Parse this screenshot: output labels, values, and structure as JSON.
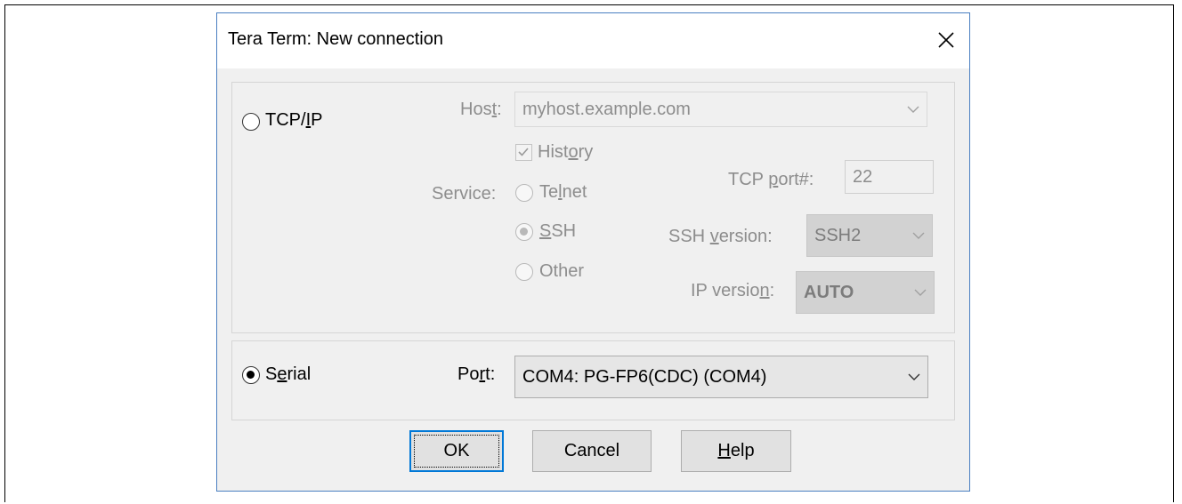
{
  "dialog": {
    "title": "Tera Term: New connection"
  },
  "tcpip": {
    "radio_label_a": "TCP/",
    "radio_label_u": "I",
    "radio_label_b": "P",
    "host_label_a": "Hos",
    "host_label_u": "t",
    "host_label_b": ":",
    "host_value": "myhost.example.com",
    "history_label_a": "Hist",
    "history_label_u": "o",
    "history_label_b": "ry",
    "service_label": "Service:",
    "telnet_label_a": "Te",
    "telnet_label_u": "l",
    "telnet_label_b": "net",
    "ssh_label_u": "S",
    "ssh_label_b": "SH",
    "other_label": "Other",
    "tcp_port_label_a": "TCP ",
    "tcp_port_label_u": "p",
    "tcp_port_label_b": "ort#:",
    "tcp_port_value": "22",
    "ssh_version_label_a": "SSH ",
    "ssh_version_label_u": "v",
    "ssh_version_label_b": "ersion:",
    "ssh_version_value": "SSH2",
    "ip_version_label_a": "IP versio",
    "ip_version_label_u": "n",
    "ip_version_label_b": ":",
    "ip_version_value": "AUTO"
  },
  "serial": {
    "radio_label_a": "S",
    "radio_label_u": "e",
    "radio_label_b": "rial",
    "port_label_a": "Po",
    "port_label_u": "r",
    "port_label_b": "t:",
    "port_value": "COM4: PG-FP6(CDC) (COM4)"
  },
  "buttons": {
    "ok": "OK",
    "cancel": "Cancel",
    "help_u": "H",
    "help_b": "elp"
  },
  "colors": {
    "dialog_border": "#4a7fc1",
    "disabled_text": "#8d8d8d",
    "focus_border": "#0078d7"
  },
  "icons": {
    "close": "close-icon",
    "dropdown": "chevron-down-icon",
    "check": "check-icon"
  }
}
